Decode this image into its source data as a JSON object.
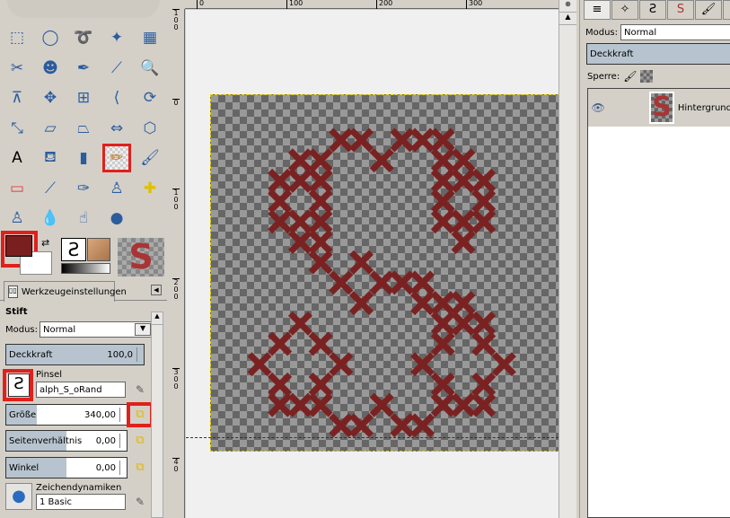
{
  "toolbox": {
    "tools": [
      "rect-select",
      "ellipse-select",
      "free-select",
      "fuzzy-select",
      "select-by-color",
      "scissors-select",
      "foreground-select",
      "paths",
      "color-picker",
      "zoom",
      "measure",
      "move",
      "align",
      "crop",
      "rotate",
      "scale",
      "shear",
      "perspective",
      "flip",
      "cage-transform",
      "text",
      "bucket-fill",
      "blend",
      "pencil",
      "paintbrush",
      "eraser",
      "airbrush",
      "ink",
      "clone",
      "heal",
      "perspective-clone",
      "blur",
      "smudge",
      "dodge-burn"
    ],
    "selected_tool": "pencil",
    "foreground_color": "#7a1f1f",
    "background_color": "#ffffff"
  },
  "tool_options": {
    "tab_label": "Werkzeugeinstellungen",
    "tool_name": "Stift",
    "mode_label": "Modus:",
    "mode_value": "Normal",
    "opacity": {
      "label": "Deckkraft",
      "value": "100,0",
      "fraction": 1.0
    },
    "brush": {
      "label": "Pinsel",
      "value": "alph_S_oRand"
    },
    "size": {
      "label": "Größe",
      "value": "340,00",
      "fraction": 0.25
    },
    "aspect": {
      "label": "Seitenverhältnis",
      "value": "0,00",
      "fraction": 0.5
    },
    "angle": {
      "label": "Winkel",
      "value": "0,00",
      "fraction": 0.5
    },
    "dynamics": {
      "label": "Zeichendynamiken",
      "value": "1 Basic"
    }
  },
  "rulers": {
    "horizontal": [
      "0",
      "100",
      "200",
      "300"
    ],
    "vertical": [
      "100",
      "0",
      "100",
      "200",
      "300",
      "40"
    ]
  },
  "canvas": {
    "stitch_color": "#7a2222"
  },
  "layers_panel": {
    "mode_label": "Modus:",
    "mode_value": "Normal",
    "opacity_label": "Deckkraft",
    "lock_label": "Sperre:",
    "layers": [
      {
        "name": "Hintergrund"
      }
    ]
  }
}
